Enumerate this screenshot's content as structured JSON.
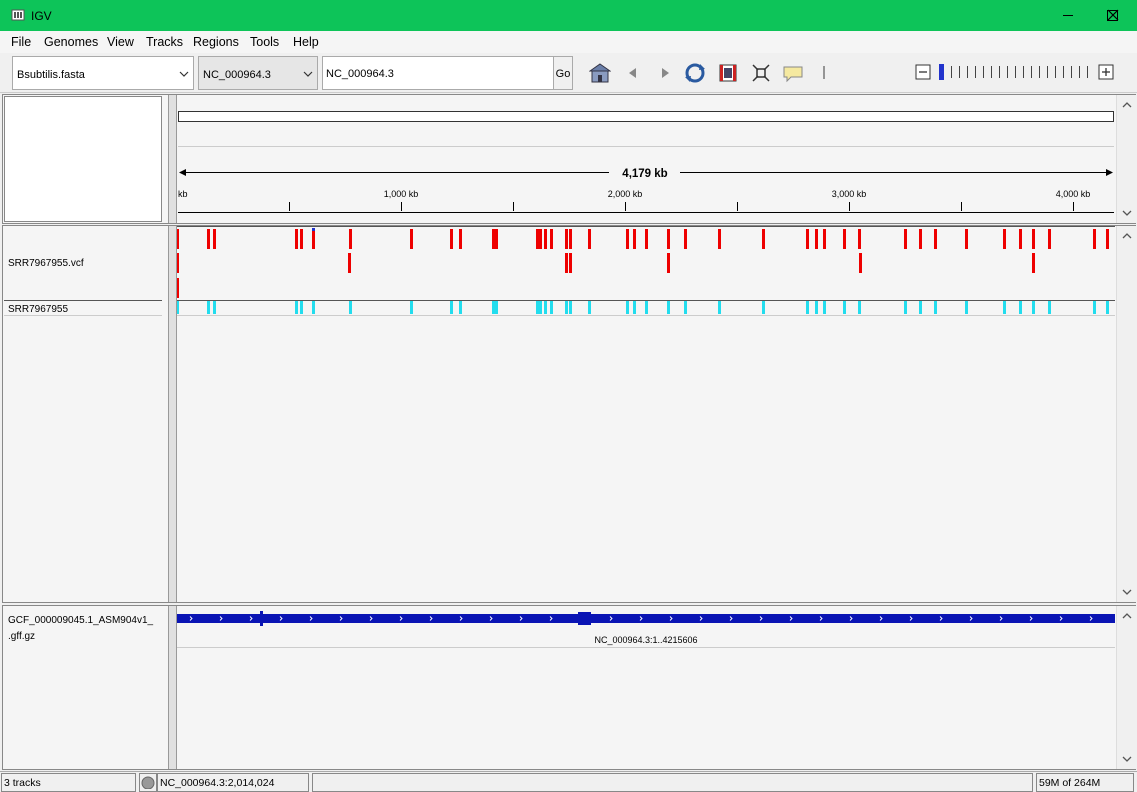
{
  "window": {
    "title": "IGV"
  },
  "menu": [
    "File",
    "Genomes",
    "View",
    "Tracks",
    "Regions",
    "Tools",
    "Help"
  ],
  "toolbar": {
    "genome": "Bsubtilis.fasta",
    "chromosome": "NC_000964.3",
    "locus": "NC_000964.3",
    "go_label": "Go"
  },
  "ruler": {
    "span_label": "4,179 kb",
    "start_label": "kb",
    "ticks": [
      "1,000 kb",
      "2,000 kb",
      "3,000 kb",
      "4,000 kb"
    ]
  },
  "tracks": {
    "vcf_name": "SRR7967955.vcf",
    "sample_name": "SRR7967955",
    "gff_name_line1": "GCF_000009045.1_ASM904v1_",
    "gff_name_line2": ".gff.gz",
    "gene_label": "NC_000964.3:1..4215606"
  },
  "status": {
    "tracks": "3 tracks",
    "position": "NC_000964.3:2,014,024",
    "memory": "59M of 264M"
  },
  "colors": {
    "titlebar": "#0dc459",
    "variant": "#ee0000",
    "genotype": "#22ddee",
    "gene": "#0a14b4"
  }
}
